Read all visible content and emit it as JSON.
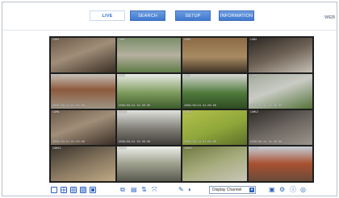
{
  "nav": {
    "tabs": [
      {
        "label": "LIVE",
        "active": true
      },
      {
        "label": "SEARCH",
        "active": false
      },
      {
        "label": "SETUP",
        "active": false
      },
      {
        "label": "INFORMATION",
        "active": false
      }
    ],
    "brand": "WEB"
  },
  "cameras": [
    {
      "label": "CAM1",
      "timestamp": "",
      "scene": "indoor-hallway"
    },
    {
      "label": "CAM2",
      "timestamp": "",
      "scene": "outdoor-garden"
    },
    {
      "label": "CAM3",
      "timestamp": "",
      "scene": "stone-wall"
    },
    {
      "label": "CAM4",
      "timestamp": "",
      "scene": "indoor-room"
    },
    {
      "label": "CAM5",
      "timestamp": "2009/09/24 01:00:00",
      "scene": "patio"
    },
    {
      "label": "CAM6",
      "timestamp": "2009/09/24 01:00:00",
      "scene": "trees"
    },
    {
      "label": "CAM7",
      "timestamp": "2009/09/24 01:00:00",
      "scene": "garden-lamp"
    },
    {
      "label": "CAM8",
      "timestamp": "2009/09/24 01:00:00",
      "scene": "driveway"
    },
    {
      "label": "CAM9",
      "timestamp": "2009/09/24 01:00:00",
      "scene": "indoor-hallway"
    },
    {
      "label": "CAM10",
      "timestamp": "2009/09/24 01:00:00",
      "scene": "outdoor-path"
    },
    {
      "label": "CAM11",
      "timestamp": "2009/09/24 01:00:00",
      "scene": "green-wall"
    },
    {
      "label": "CAM12",
      "timestamp": "2009/09/24 01:00:00",
      "scene": "office-room"
    },
    {
      "label": "CAM13",
      "timestamp": "",
      "scene": "entrance"
    },
    {
      "label": "CAM14",
      "timestamp": "",
      "scene": "lobby"
    },
    {
      "label": "CAM15",
      "timestamp": "",
      "scene": "storage"
    },
    {
      "label": "CAM16",
      "timestamp": "",
      "scene": "building"
    }
  ],
  "toolbar": {
    "layout_icons": [
      "single-view-icon",
      "quad-view-icon",
      "nine-view-icon",
      "sixteen-view-icon",
      "full-view-icon"
    ],
    "action_icons": [
      "capture-icon",
      "record-icon",
      "audio-icon",
      "fullscreen-icon"
    ],
    "tool_icons": [
      "pen-icon",
      "sound-icon"
    ],
    "display_select": "Display Channel",
    "right_icons": [
      "save-icon",
      "settings-icon",
      "info-icon",
      "help-icon"
    ]
  }
}
